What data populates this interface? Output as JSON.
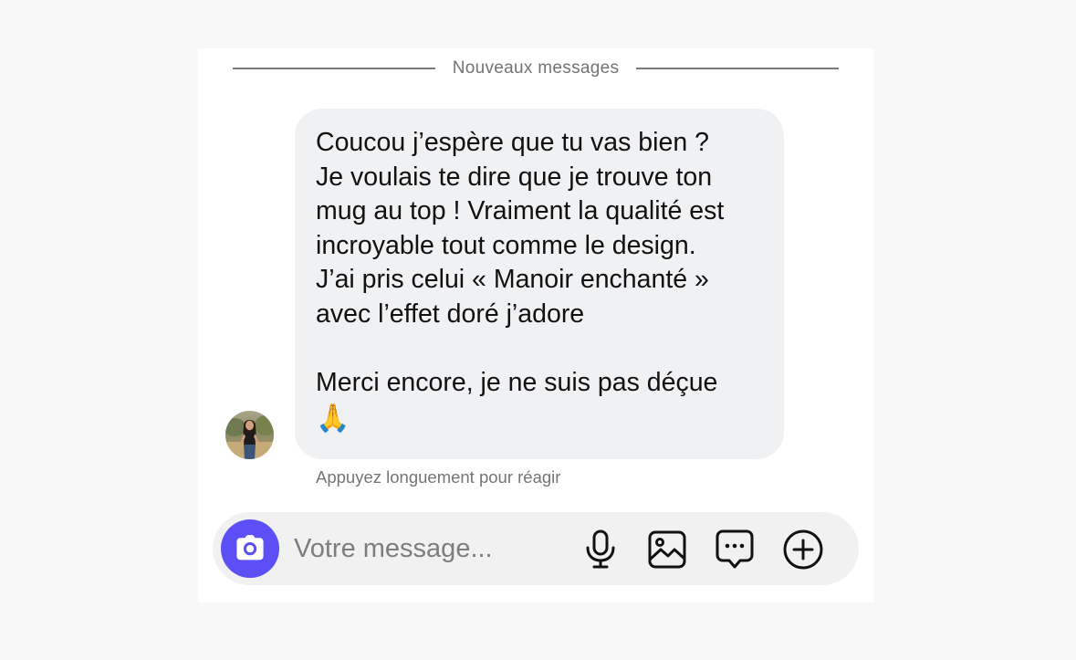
{
  "divider": {
    "label": "Nouveaux messages"
  },
  "message": {
    "text": "Coucou j’espère que tu vas bien ?\nJe voulais te dire que je trouve ton\nmug au top ! Vraiment la qualité est\nincroyable tout comme le design.\nJ’ai pris celui «  Manoir enchanté  »\navec l’effet doré j’adore\n\nMerci encore, je ne suis pas déçue",
    "emoji": "🙏"
  },
  "hint": "Appuyez longuement pour réagir",
  "composer": {
    "placeholder": "Votre message..."
  },
  "icons": {
    "camera": "camera-icon",
    "microphone": "microphone-icon",
    "image": "image-icon",
    "chat": "chat-bubble-icon",
    "add": "plus-circle-icon"
  },
  "colors": {
    "accent": "#5b4ff5",
    "bubble": "#f0f1f3",
    "background": "#f8f8f9"
  }
}
